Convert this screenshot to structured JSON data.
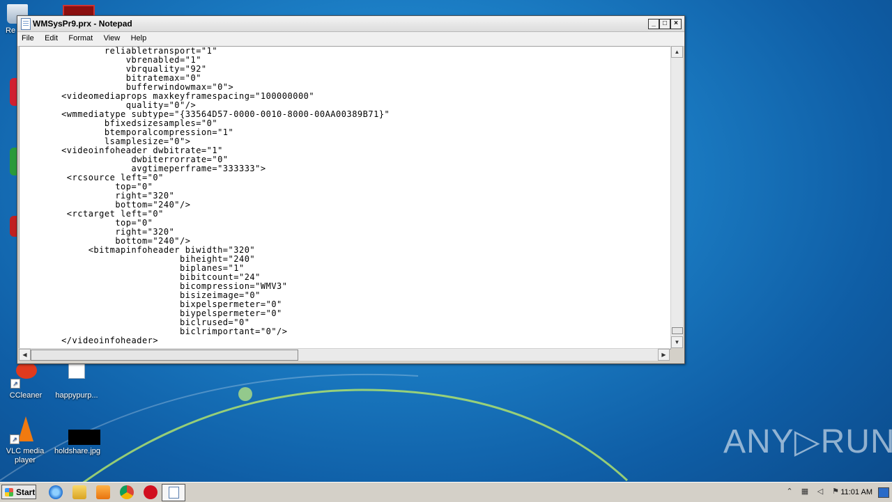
{
  "window": {
    "title": "WMSysPr9.prx - Notepad",
    "menu": [
      "File",
      "Edit",
      "Format",
      "View",
      "Help"
    ],
    "content_lines": [
      "               reliabletransport=\"1\"",
      "                   vbrenabled=\"1\"",
      "                   vbrquality=\"92\"",
      "                   bitratemax=\"0\"",
      "                   bufferwindowmax=\"0\">",
      "       <videomediaprops maxkeyframespacing=\"100000000\"",
      "                   quality=\"0\"/>",
      "       <wmmediatype subtype=\"{33564D57-0000-0010-8000-00AA00389B71}\"",
      "               bfixedsizesamples=\"0\"",
      "               btemporalcompression=\"1\"",
      "               lsamplesize=\"0\">",
      "       <videoinfoheader dwbitrate=\"1\"",
      "                    dwbiterrorrate=\"0\"",
      "                    avgtimeperframe=\"333333\">",
      "        <rcsource left=\"0\"",
      "                 top=\"0\"",
      "                 right=\"320\"",
      "                 bottom=\"240\"/>",
      "        <rctarget left=\"0\"",
      "                 top=\"0\"",
      "                 right=\"320\"",
      "                 bottom=\"240\"/>",
      "            <bitmapinfoheader biwidth=\"320\"",
      "                             biheight=\"240\"",
      "                             biplanes=\"1\"",
      "                             bibitcount=\"24\"",
      "                             bicompression=\"WMV3\"",
      "                             bisizeimage=\"0\"",
      "                             bixpelspermeter=\"0\"",
      "                             biypelspermeter=\"0\"",
      "                             biclrused=\"0\"",
      "                             biclrimportant=\"0\"/>",
      "       </videoinfoheader>"
    ]
  },
  "desktop": {
    "icons": [
      {
        "label": "CCleaner",
        "icon": "ccleaner-icon"
      },
      {
        "label": "happypurp...",
        "icon": "document-icon"
      },
      {
        "label": "VLC media player",
        "icon": "vlc-cone-icon"
      },
      {
        "label": "holdshare.jpg",
        "icon": "image-file-icon"
      }
    ],
    "partial_label": "Re"
  },
  "taskbar": {
    "start_label": "Start",
    "clock": "11:01 AM",
    "pinned": [
      "ie-icon",
      "explorer-icon",
      "media-player-icon",
      "chrome-icon",
      "opera-icon",
      "notepad-icon"
    ]
  },
  "watermark": "ANY▷RUN"
}
